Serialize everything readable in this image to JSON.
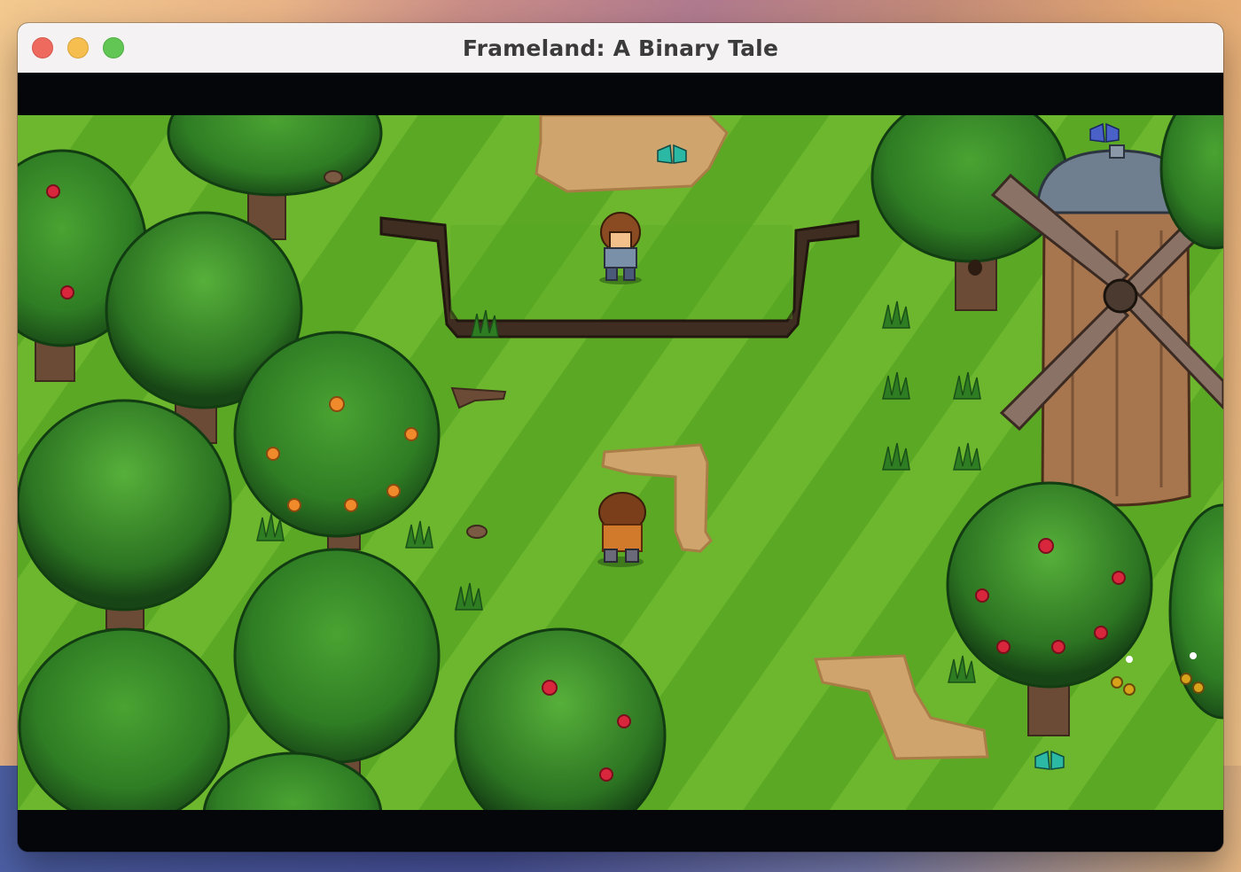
{
  "window": {
    "title": "Frameland: A Binary Tale",
    "controls": {
      "close": "close-icon",
      "minimize": "minimize-icon",
      "maximize": "maximize-icon"
    }
  },
  "colors": {
    "grass": "#5aa824",
    "grass_stripe": "#6cb72d",
    "path": "#cfa56d",
    "tree_dark": "#1f5a1a",
    "tree_light": "#3f9a2c",
    "trunk": "#6b4a36",
    "letterbox": "#04060a"
  },
  "icons": [
    "player-character-icon",
    "npc-villager-icon",
    "windmill-icon",
    "tree-icon",
    "butterfly-icon",
    "flower-icon"
  ]
}
